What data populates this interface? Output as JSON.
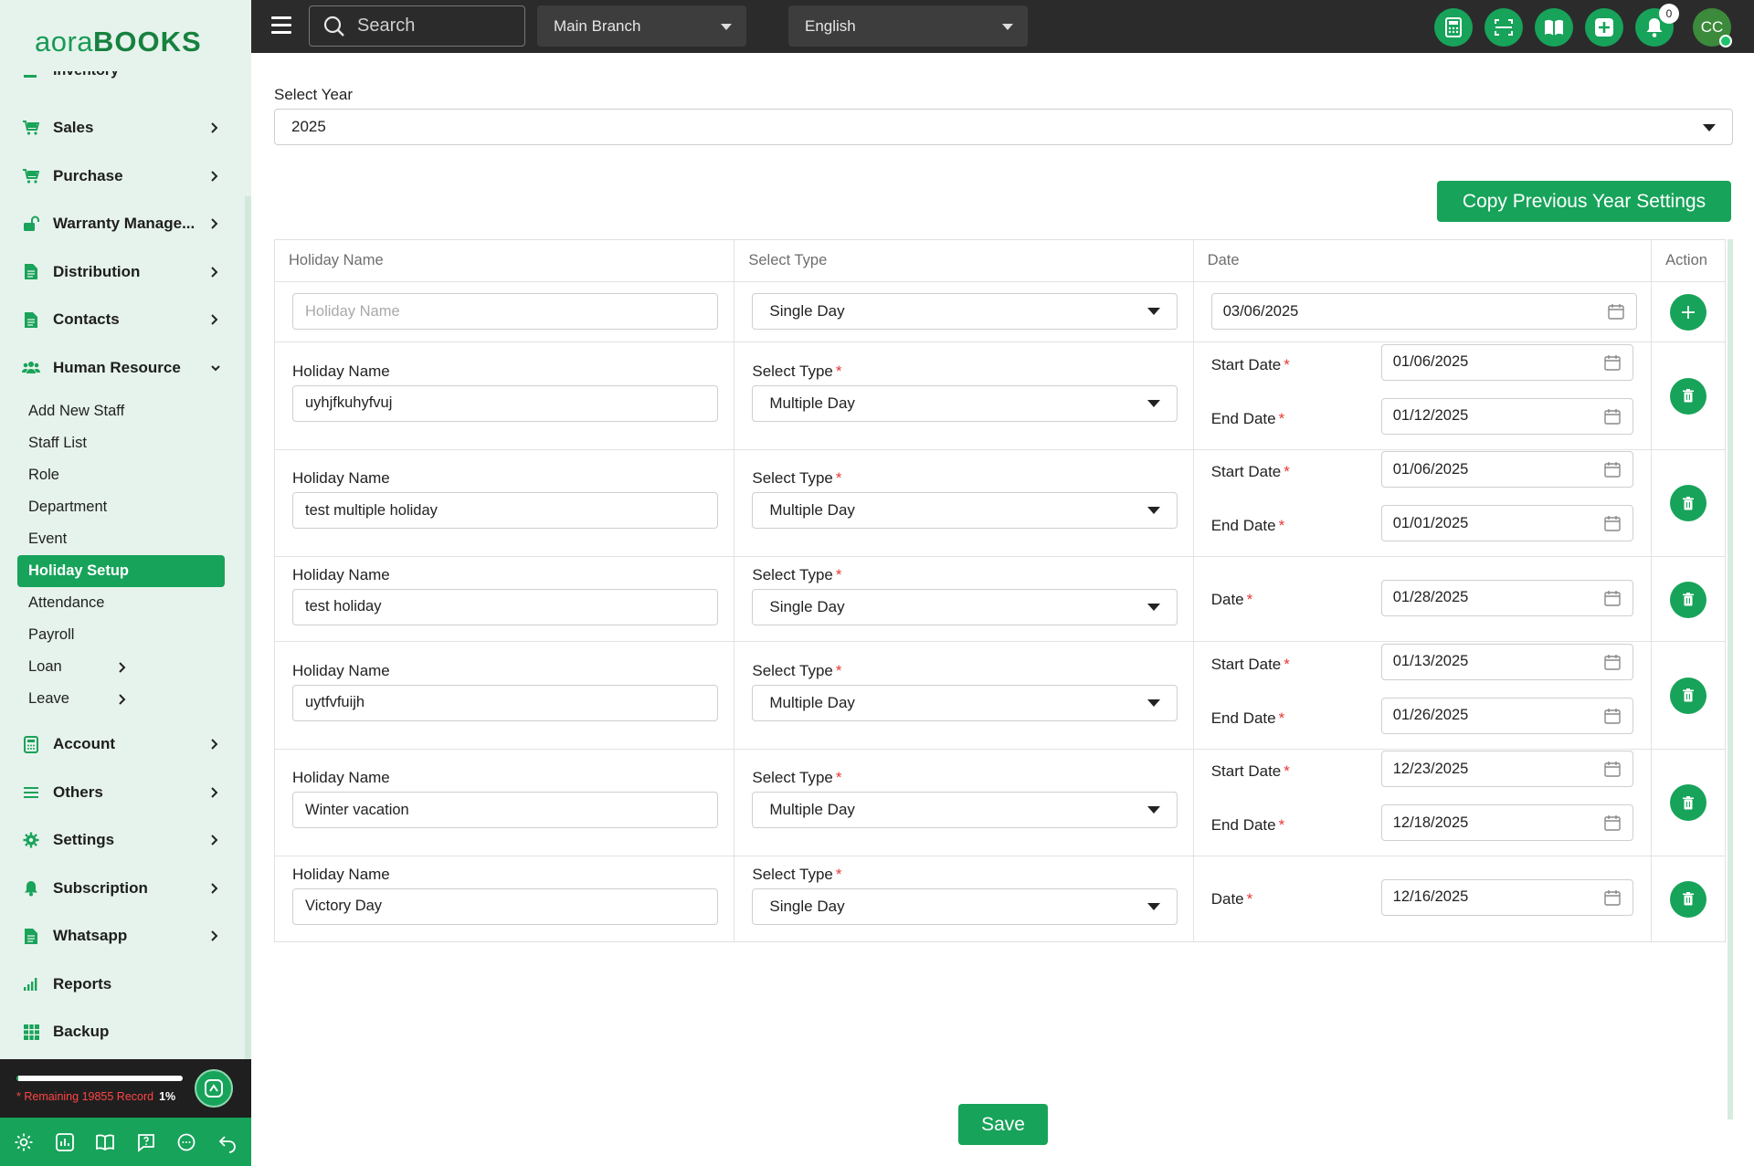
{
  "app": {
    "logo_part1": "aora",
    "logo_part2": "BOOKS"
  },
  "topbar": {
    "search_placeholder": "Search",
    "branch": "Main Branch",
    "language": "English",
    "notification_count": "0",
    "avatar_initials": "CC"
  },
  "sidebar": {
    "cut_item": "Inventory",
    "items_top": [
      {
        "label": "Sales",
        "icon": "cart-icon"
      },
      {
        "label": "Purchase",
        "icon": "cart-icon"
      },
      {
        "label": "Warranty Manage...",
        "icon": "unlock-icon"
      },
      {
        "label": "Distribution",
        "icon": "document-icon"
      },
      {
        "label": "Contacts",
        "icon": "document-icon"
      }
    ],
    "hr_label": "Human Resource",
    "hr_sub": [
      {
        "label": "Add New Staff"
      },
      {
        "label": "Staff List"
      },
      {
        "label": "Role"
      },
      {
        "label": "Department"
      },
      {
        "label": "Event"
      },
      {
        "label": "Holiday Setup"
      },
      {
        "label": "Attendance"
      },
      {
        "label": "Payroll"
      },
      {
        "label": "Loan"
      },
      {
        "label": "Leave"
      }
    ],
    "items_bottom": [
      {
        "label": "Account",
        "icon": "calculator-icon"
      },
      {
        "label": "Others",
        "icon": "list-icon"
      },
      {
        "label": "Settings",
        "icon": "gear-icon"
      },
      {
        "label": "Subscription",
        "icon": "bell-icon"
      },
      {
        "label": "Whatsapp",
        "icon": "document-icon"
      },
      {
        "label": "Reports",
        "icon": "bar-chart-icon"
      },
      {
        "label": "Backup",
        "icon": "grid-icon"
      }
    ],
    "usage": {
      "text": "* Remaining 19855 Record",
      "percent_label": "1%",
      "percent": 1
    }
  },
  "main": {
    "year_label": "Select Year",
    "year_value": "2025",
    "copy_button": "Copy Previous Year Settings",
    "columns": [
      "Holiday Name",
      "Select Type",
      "Date",
      "Action"
    ],
    "new_row": {
      "name_placeholder": "Holiday Name",
      "type": "Single Day",
      "date": "03/06/2025"
    },
    "labels": {
      "holiday_name": "Holiday Name",
      "select_type": "Select Type",
      "start_date": "Start Date",
      "end_date": "End Date",
      "date": "Date",
      "required": "*"
    },
    "rows": [
      {
        "name": "uyhjfkuhyfvuj",
        "type": "Multiple Day",
        "start": "01/06/2025",
        "end": "01/12/2025"
      },
      {
        "name": "test multiple holiday",
        "type": "Multiple Day",
        "start": "01/06/2025",
        "end": "01/01/2025"
      },
      {
        "name": "test holiday",
        "type": "Single Day",
        "date": "01/28/2025"
      },
      {
        "name": "uytfvfuijh",
        "type": "Multiple Day",
        "start": "01/13/2025",
        "end": "01/26/2025"
      },
      {
        "name": "Winter vacation",
        "type": "Multiple Day",
        "start": "12/23/2025",
        "end": "12/18/2025"
      },
      {
        "name": "Victory Day",
        "type": "Single Day",
        "date": "12/16/2025"
      }
    ],
    "save_button": "Save"
  },
  "colors": {
    "accent": "#17a35a",
    "sidebar_bg": "#e6f3ec",
    "topbar_bg": "#2b2b2b",
    "required": "#e53935"
  }
}
